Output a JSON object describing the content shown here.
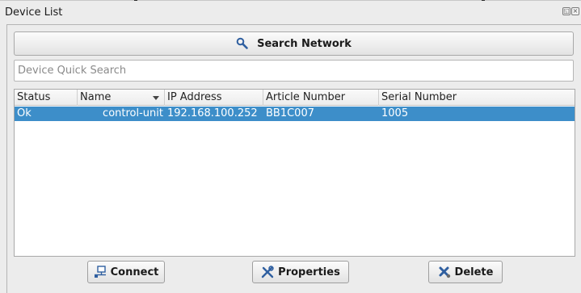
{
  "window": {
    "title": "Device List",
    "float_icon": "float-icon",
    "close_icon": "close-icon"
  },
  "toolbar": {
    "search_label": "Search Network",
    "search_icon": "magnifier-icon"
  },
  "quick_search": {
    "placeholder": "Device Quick Search",
    "value": ""
  },
  "table": {
    "columns": [
      "Status",
      "Name",
      "IP Address",
      "Article Number",
      "Serial Number"
    ],
    "sorted_column": "Name",
    "rows": [
      {
        "status": "Ok",
        "name": "control-unit",
        "ip": "192.168.100.252",
        "article": "BB1C007",
        "serial": "1005",
        "selected": true
      }
    ]
  },
  "actions": {
    "connect_label": "Connect",
    "properties_label": "Properties",
    "delete_label": "Delete"
  },
  "colors": {
    "selection": "#3d8ec9",
    "background": "#ececec"
  }
}
